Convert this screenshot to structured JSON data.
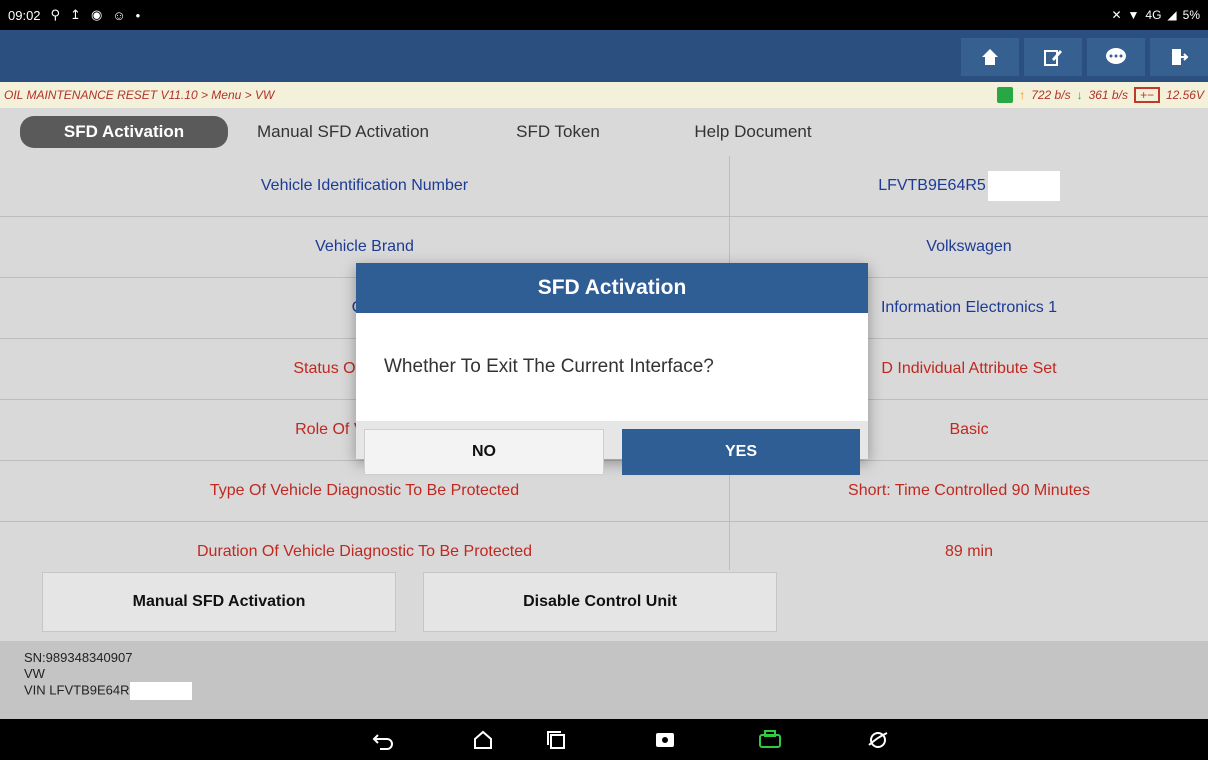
{
  "status_bar": {
    "time": "09:02",
    "left_icons": [
      "usb-icon",
      "upload-icon",
      "media-icon",
      "chat-icon"
    ],
    "right_text": "4G",
    "battery_text": "5%"
  },
  "breadcrumb": {
    "path": "OIL MAINTENANCE RESET V11.10 > Menu > VW",
    "upload_rate": "722 b/s",
    "download_rate": "361 b/s",
    "voltage": "12.56V"
  },
  "tabs": [
    {
      "label": "SFD Activation",
      "active": true
    },
    {
      "label": "Manual SFD Activation",
      "active": false
    },
    {
      "label": "SFD Token",
      "active": false
    },
    {
      "label": "Help Document",
      "active": false
    }
  ],
  "rows": [
    {
      "label": "Vehicle Identification Number",
      "value": "LFVTB9E64R5",
      "color": "blue",
      "redacted": true
    },
    {
      "label": "Vehicle Brand",
      "value": "Volkswagen",
      "color": "blue"
    },
    {
      "label": "Cor",
      "value": "Information Electronics 1",
      "color": "blue"
    },
    {
      "label": "Status Of Vehicle Di",
      "value": "D Individual Attribute Set",
      "color": "red"
    },
    {
      "label": "Role Of Vehicle Dia",
      "value": "Basic",
      "color": "red"
    },
    {
      "label": "Type Of Vehicle Diagnostic To Be Protected",
      "value": "Short: Time Controlled 90 Minutes",
      "color": "red"
    },
    {
      "label": "Duration Of Vehicle Diagnostic To Be Protected",
      "value": "89 min",
      "color": "red"
    }
  ],
  "bottom_buttons": {
    "manual": "Manual SFD Activation",
    "disable": "Disable Control Unit"
  },
  "info": {
    "sn": "SN:989348340907",
    "make": "VW",
    "vin": "VIN LFVTB9E64R"
  },
  "dialog": {
    "title": "SFD Activation",
    "message": "Whether To Exit The Current Interface?",
    "no_label": "NO",
    "yes_label": "YES"
  },
  "colors": {
    "header": "#2b4f7f",
    "dialog_title": "#2f5e95",
    "blue_text": "#1d3b95",
    "red_text": "#c02820"
  }
}
